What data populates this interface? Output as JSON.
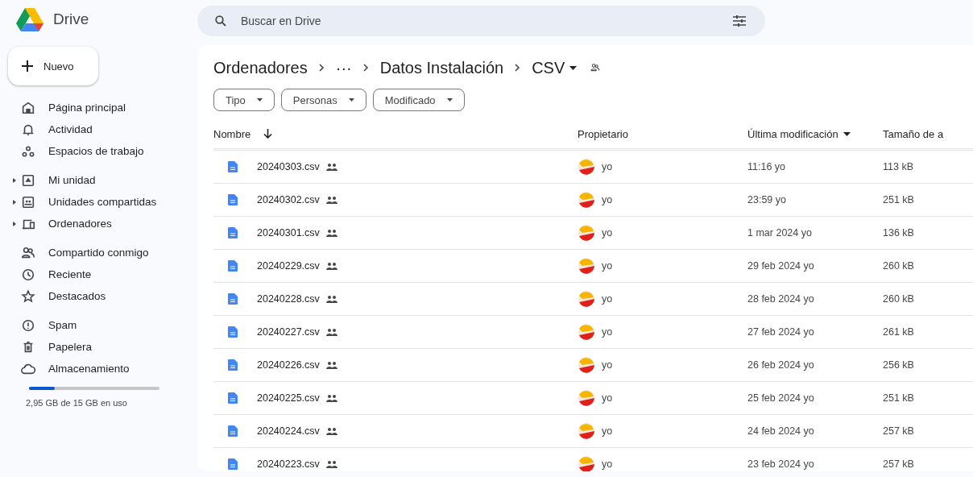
{
  "app": {
    "name": "Drive"
  },
  "search": {
    "placeholder": "Buscar en Drive"
  },
  "new_button": {
    "label": "Nuevo"
  },
  "sidebar": {
    "groups": [
      [
        {
          "kind": "home",
          "label": "Página principal",
          "expandable": false
        },
        {
          "kind": "bell",
          "label": "Actividad",
          "expandable": false
        },
        {
          "kind": "workspaces",
          "label": "Espacios de trabajo",
          "expandable": false
        }
      ],
      [
        {
          "kind": "drive",
          "label": "Mi unidad",
          "expandable": true
        },
        {
          "kind": "shared-drives",
          "label": "Unidades compartidas",
          "expandable": true
        },
        {
          "kind": "computers",
          "label": "Ordenadores",
          "expandable": true
        }
      ],
      [
        {
          "kind": "shared",
          "label": "Compartido conmigo",
          "expandable": false
        },
        {
          "kind": "clock",
          "label": "Reciente",
          "expandable": false
        },
        {
          "kind": "star",
          "label": "Destacados",
          "expandable": false
        }
      ],
      [
        {
          "kind": "spam",
          "label": "Spam",
          "expandable": false
        },
        {
          "kind": "trash",
          "label": "Papelera",
          "expandable": false
        },
        {
          "kind": "cloud",
          "label": "Almacenamiento",
          "expandable": false
        }
      ]
    ]
  },
  "storage": {
    "level": 0.2,
    "text": "2,95 GB de 15 GB en uso"
  },
  "breadcrumb": [
    {
      "label": "Ordenadores"
    },
    {
      "label": "···"
    },
    {
      "label": "Datos Instalación"
    },
    {
      "label": "CSV"
    }
  ],
  "filters": [
    {
      "label": "Tipo"
    },
    {
      "label": "Personas"
    },
    {
      "label": "Modificado"
    }
  ],
  "table": {
    "columns": [
      {
        "label": "Nombre",
        "kind": "arrow"
      },
      {
        "label": "Propietario",
        "kind": "plain"
      },
      {
        "label": "Última modificación",
        "kind": "caret"
      },
      {
        "label": "Tamaño de a",
        "kind": "plain"
      }
    ],
    "rows": [
      {
        "name": "20240303.csv",
        "owner": "yo",
        "modified": "11:16 yo",
        "size": "113 kB"
      },
      {
        "name": "20240302.csv",
        "owner": "yo",
        "modified": "23:59 yo",
        "size": "251 kB"
      },
      {
        "name": "20240301.csv",
        "owner": "yo",
        "modified": "1 mar 2024 yo",
        "size": "136 kB"
      },
      {
        "name": "20240229.csv",
        "owner": "yo",
        "modified": "29 feb 2024 yo",
        "size": "260 kB"
      },
      {
        "name": "20240228.csv",
        "owner": "yo",
        "modified": "28 feb 2024 yo",
        "size": "260 kB"
      },
      {
        "name": "20240227.csv",
        "owner": "yo",
        "modified": "27 feb 2024 yo",
        "size": "261 kB"
      },
      {
        "name": "20240226.csv",
        "owner": "yo",
        "modified": "26 feb 2024 yo",
        "size": "256 kB"
      },
      {
        "name": "20240225.csv",
        "owner": "yo",
        "modified": "25 feb 2024 yo",
        "size": "251 kB"
      },
      {
        "name": "20240224.csv",
        "owner": "yo",
        "modified": "24 feb 2024 yo",
        "size": "257 kB"
      },
      {
        "name": "20240223.csv",
        "owner": "yo",
        "modified": "23 feb 2024 yo",
        "size": "257 kB"
      }
    ]
  }
}
